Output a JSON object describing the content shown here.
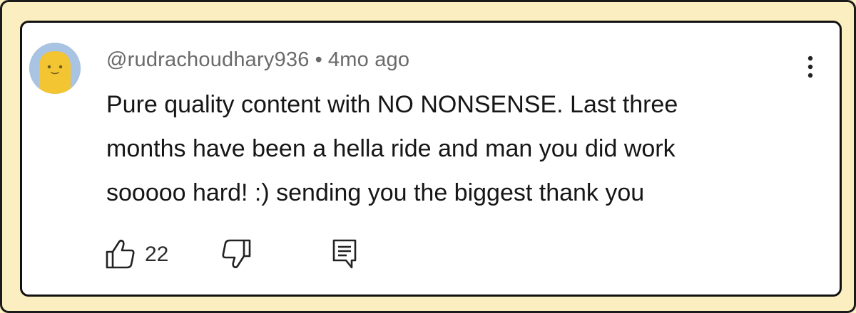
{
  "comment": {
    "author": "@rudrachoudhary936",
    "separator": "•",
    "timestamp": "4mo ago",
    "text_lines": [
      "Pure quality content with NO NONSENSE. Last three",
      "months have been a hella ride and man you did work",
      "sooooo hard! :) sending you the biggest thank you"
    ],
    "like_count": "22"
  },
  "icons": {
    "avatar": "smiley-avatar",
    "menu": "more-vert-icon",
    "like": "thumbs-up-icon",
    "dislike": "thumbs-down-icon",
    "reply": "reply-comment-icon"
  },
  "colors": {
    "frame_background": "#fbeec0",
    "card_background": "#ffffff",
    "avatar_background": "#a9c3e3",
    "avatar_face": "#f3c533",
    "meta_text": "#6a6a6a",
    "body_text": "#161616"
  }
}
